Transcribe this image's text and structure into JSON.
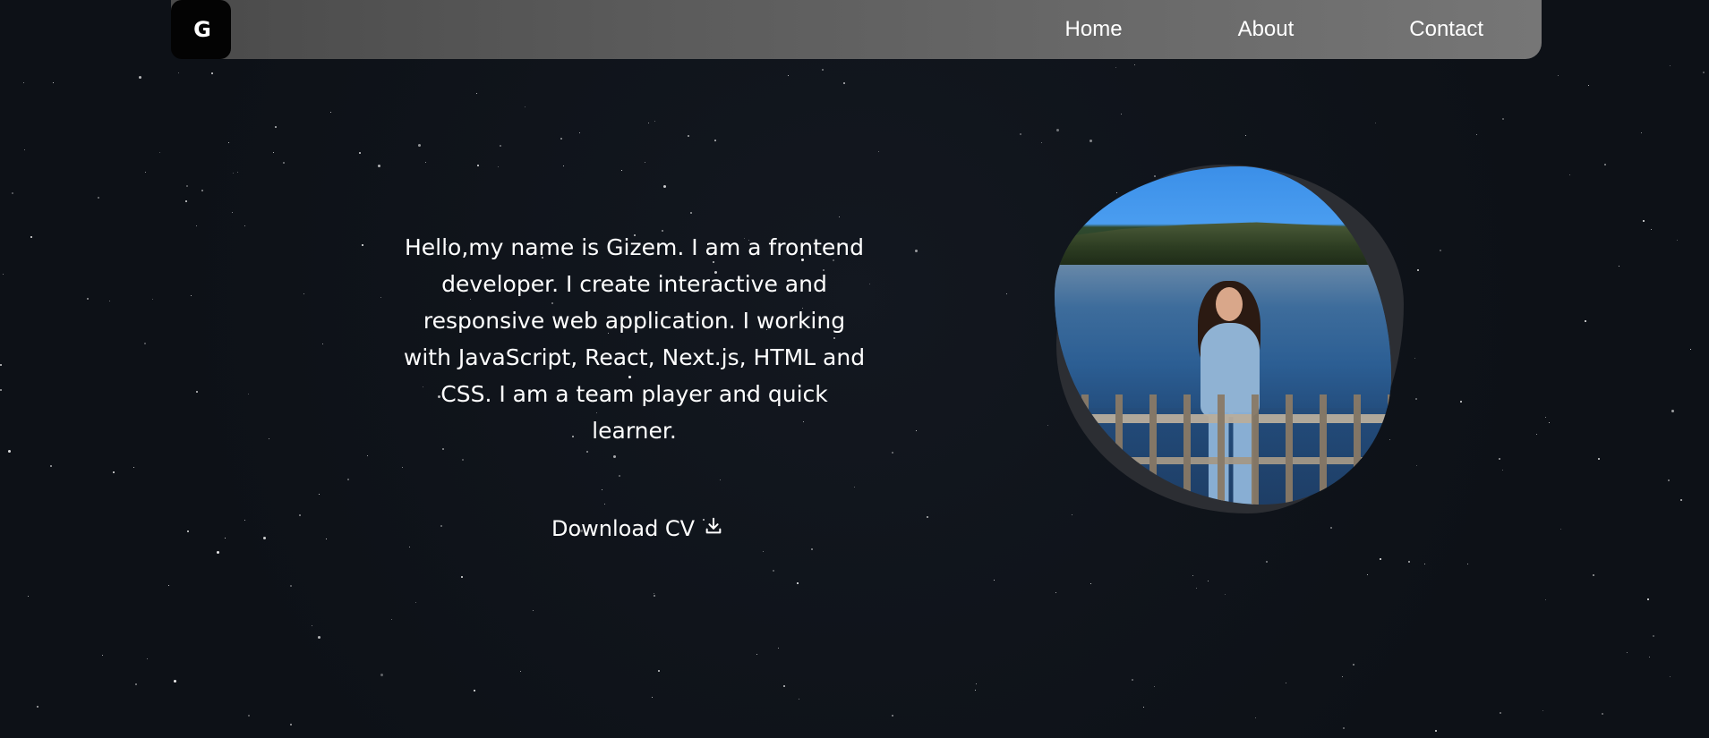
{
  "brand": {
    "logo_text": "G"
  },
  "nav": {
    "items": [
      {
        "label": "Home"
      },
      {
        "label": "About"
      },
      {
        "label": "Contact"
      }
    ]
  },
  "hero": {
    "intro_text": "Hello,my name is Gizem. I am a frontend developer. I create interactive and responsive web application. I working with JavaScript, React, Next.js, HTML and CSS. I am a team player and quick learner.",
    "download_label": "Download CV",
    "download_icon": "download-icon",
    "photo_alt": "Portrait photo"
  },
  "colors": {
    "background": "#0d1117",
    "navbar_start": "#4a4a4a",
    "navbar_end": "#767676",
    "blob_back": "#2c2e33",
    "text": "#ffffff"
  }
}
